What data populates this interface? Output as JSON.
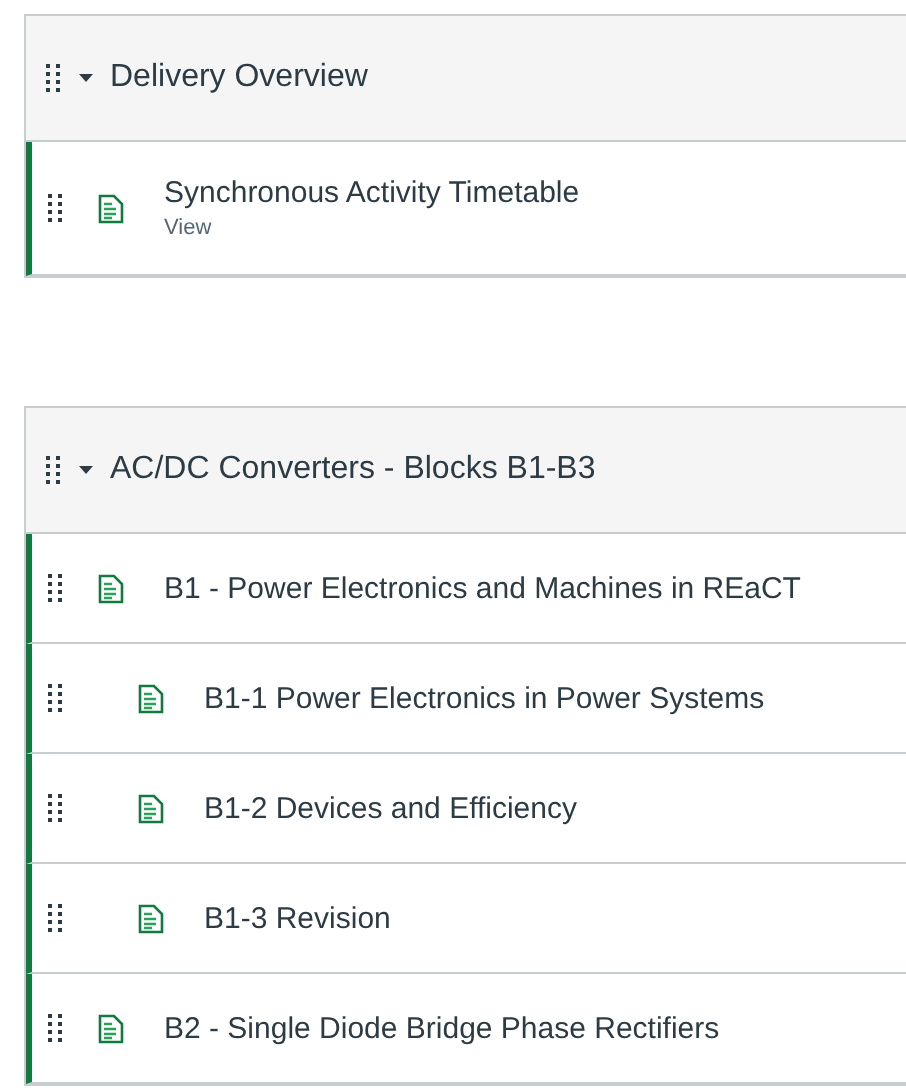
{
  "modules": [
    {
      "title": "Delivery Overview",
      "expanded": true,
      "items": [
        {
          "title": "Synchronous Activity Timetable",
          "subtitle": "View",
          "published": true
        }
      ]
    },
    {
      "title": "AC/DC Converters - Blocks B1-B3",
      "expanded": true,
      "items": [
        {
          "title": "B1 - Power Electronics and Machines in REaCT",
          "published": true,
          "children": [
            {
              "title": "B1-1 Power Electronics in Power Systems",
              "published": true
            },
            {
              "title": "B1-2 Devices and Efficiency",
              "published": true
            },
            {
              "title": "B1-3 Revision",
              "published": true
            }
          ]
        },
        {
          "title": "B2 - Single Diode Bridge Phase Rectifiers",
          "published": true
        }
      ]
    }
  ]
}
